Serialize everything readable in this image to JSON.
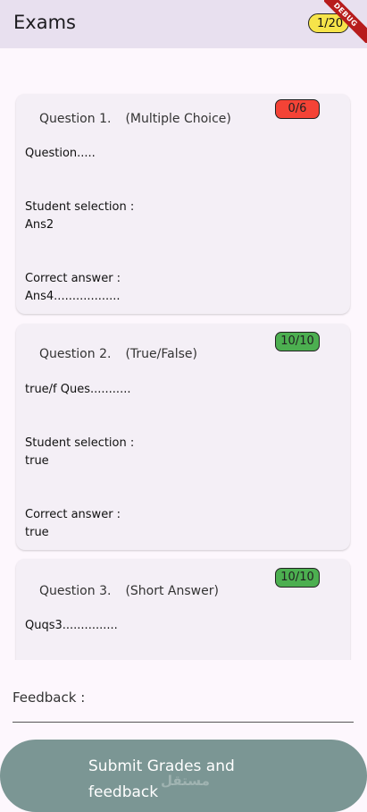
{
  "appbar": {
    "title": "Exams",
    "counter": "1/20",
    "debug_label": "DEBUG",
    "colors": {
      "bar": "#e8e0ef",
      "counter_bg": "#f6e44a"
    }
  },
  "questions": [
    {
      "number_label": "Question 1.",
      "type_label": "(Multiple Choice)",
      "score": "0/6",
      "score_color": "#f44336",
      "question_text": "Question.....",
      "student_label": "Student selection :",
      "student_answer": "Ans2",
      "correct_label": "Correct answer :",
      "correct_answer": "Ans4.................."
    },
    {
      "number_label": "Question 2.",
      "type_label": "(True/False)",
      "score": "10/10",
      "score_color": "#4caf50",
      "question_text": "true/f Ques...........",
      "student_label": "Student selection :",
      "student_answer": "true",
      "correct_label": "Correct answer :",
      "correct_answer": "true"
    },
    {
      "number_label": "Question 3.",
      "type_label": "(Short Answer)",
      "score": "10/10",
      "score_color": "#4caf50",
      "question_text": "Quqs3..............."
    }
  ],
  "feedback": {
    "label": "Feedback :"
  },
  "submit": {
    "label": "Submit Grades and feedback",
    "color": "#7b9694"
  },
  "watermark": {
    "text": "مستقل"
  }
}
